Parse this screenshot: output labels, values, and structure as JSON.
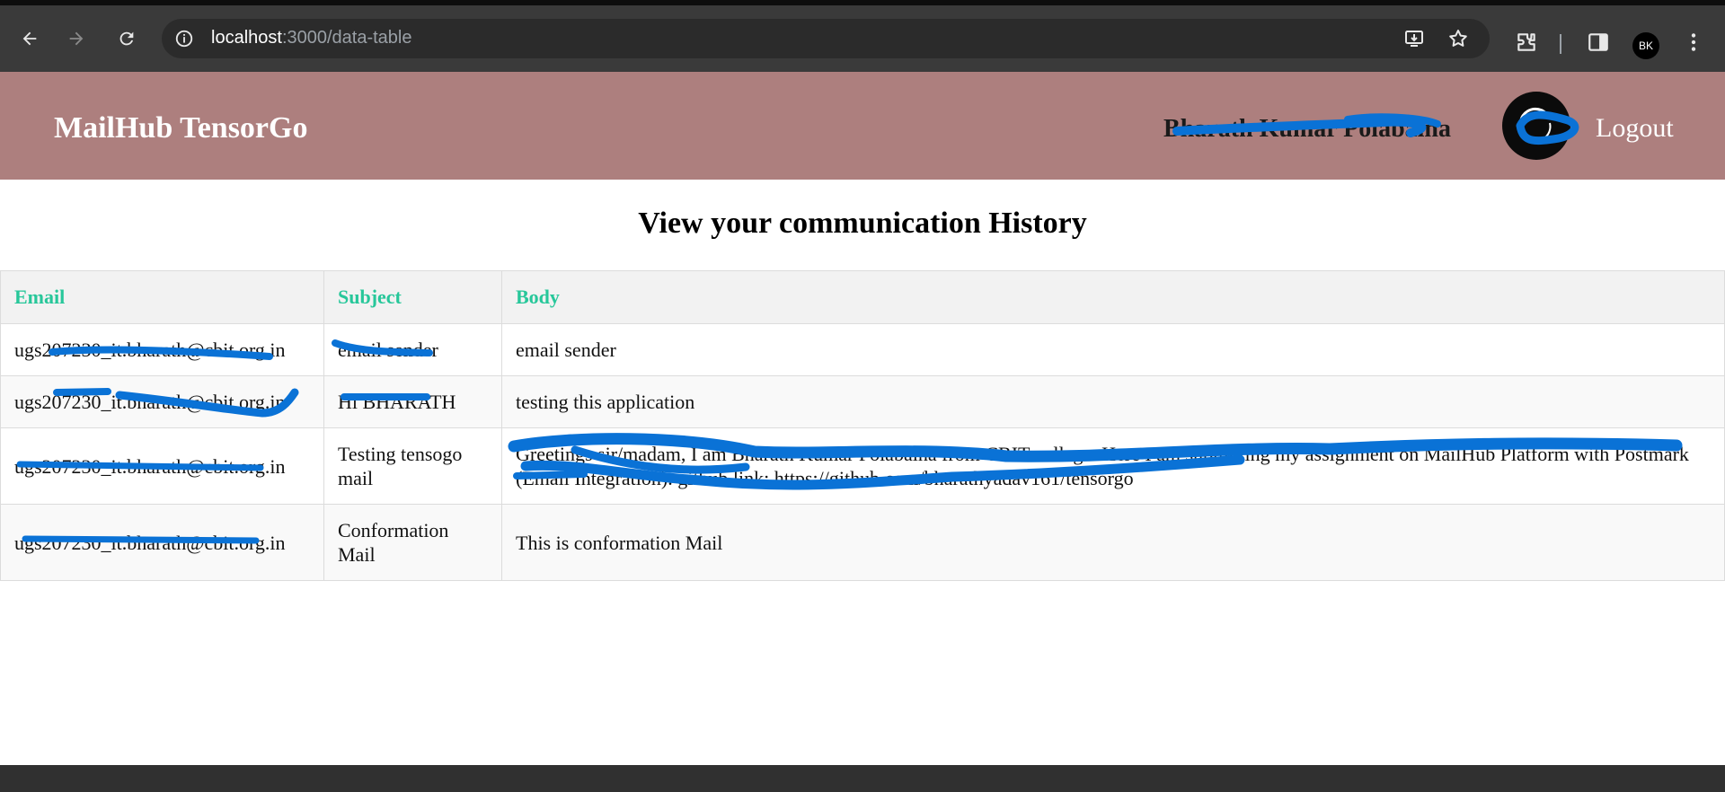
{
  "browser": {
    "url_host": "localhost",
    "url_rest": ":3000/data-table",
    "profile_initials": "BK",
    "icons": [
      "back-icon",
      "forward-icon",
      "reload-icon",
      "site-info-icon",
      "install-app-icon",
      "bookmark-star-icon",
      "extensions-icon",
      "side-panel-icon",
      "menu-dots-icon"
    ]
  },
  "header": {
    "brand": "MailHub TensorGo",
    "user_name": "Bharath Kumar Polabaina",
    "avatar_initials": "BK",
    "logout_label": "Logout"
  },
  "main": {
    "title": "View your communication History",
    "table": {
      "columns": [
        "Email",
        "Subject",
        "Body"
      ],
      "rows": [
        {
          "email": "ugs207230_it.bharath@cbit.org.in",
          "subject": "email sender",
          "body": "email sender"
        },
        {
          "email": "ugs207230_it.bharath@cbit.org.in",
          "subject": "Hi BHARATH",
          "body": "testing this application"
        },
        {
          "email": "ugs207230_it.bharath@cbit.org.in",
          "subject": "Testing tensogo mail",
          "body": "Greetings sir/madam, I am Bharath Kumar Polabaina from CBIT college. Here I am submitting my assignment on MailHub Platform with Postmark (Email Integration). github link: https://github.com/bharathyadav161/tensorgo"
        },
        {
          "email": "ugs207230_it.bharath@cbit.org.in",
          "subject": "Conformation Mail",
          "body": "This is conformation Mail"
        }
      ]
    }
  },
  "colors": {
    "header_bg": "#ad7f7e",
    "table_header_text": "#27c79a",
    "redaction": "#0a72d6"
  }
}
